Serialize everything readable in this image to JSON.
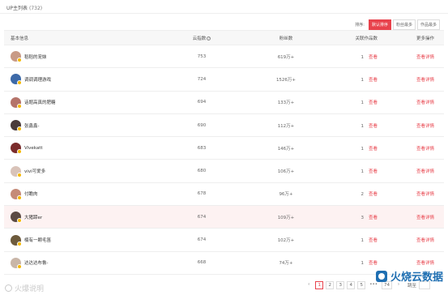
{
  "header": {
    "title": "UP主列表",
    "count": "(732)"
  },
  "sort": {
    "label": "排序:",
    "options": [
      "默认排序",
      "粉丝最多",
      "作品最多"
    ],
    "active_index": 0
  },
  "table": {
    "columns": {
      "info": "基本信息",
      "cloud": "云指数",
      "fans": "粉丝数",
      "works": "关联作品数",
      "op": "更多操作"
    },
    "rows": [
      {
        "name": "稻稻的宠妹",
        "cloud": "753",
        "fans": "619万+",
        "works": "1",
        "view": "查看",
        "detail": "查看详情",
        "avatar_color": "#c89a86"
      },
      {
        "name": "调调调理游戏",
        "cloud": "724",
        "fans": "1526万+",
        "works": "1",
        "view": "查看",
        "detail": "查看详情",
        "avatar_color": "#3d6aa8"
      },
      {
        "name": "话题高真的肥糖",
        "cloud": "694",
        "fans": "133万+",
        "works": "1",
        "view": "查看",
        "detail": "查看详情",
        "avatar_color": "#b5746a"
      },
      {
        "name": "张鑫鑫-",
        "cloud": "690",
        "fans": "112万+",
        "works": "1",
        "view": "查看",
        "detail": "查看详情",
        "avatar_color": "#4a3b3a"
      },
      {
        "name": "Vivekatt",
        "cloud": "683",
        "fans": "146万+",
        "works": "1",
        "view": "查看",
        "detail": "查看详情",
        "avatar_color": "#7a2b2b"
      },
      {
        "name": "vivi可爱多",
        "cloud": "680",
        "fans": "106万+",
        "works": "1",
        "view": "查看",
        "detail": "查看详情",
        "avatar_color": "#d9c3b9"
      },
      {
        "name": "付瞻肉",
        "cloud": "678",
        "fans": "96万+",
        "works": "2",
        "view": "查看",
        "detail": "查看详情",
        "avatar_color": "#c58b78"
      },
      {
        "name": "大猪蹄er",
        "cloud": "674",
        "fans": "109万+",
        "works": "3",
        "view": "查看",
        "detail": "查看详情",
        "avatar_color": "#5b4a44",
        "highlight": true
      },
      {
        "name": "楠有一颗毛笛",
        "cloud": "674",
        "fans": "102万+",
        "works": "1",
        "view": "查看",
        "detail": "查看详情",
        "avatar_color": "#6d5a3c"
      },
      {
        "name": "达达达布鲁-",
        "cloud": "668",
        "fans": "74万+",
        "works": "1",
        "view": "查看",
        "detail": "查看详情",
        "avatar_color": "#c9b6a8"
      }
    ]
  },
  "pagination": {
    "prev": "‹",
    "pages": [
      "1",
      "2",
      "3",
      "4",
      "5"
    ],
    "active": "1",
    "ellipsis": "•••",
    "last": "74",
    "next": "›",
    "goto": "跳至"
  },
  "watermarks": {
    "left": "火爆说明",
    "right": "火烧云数据"
  }
}
